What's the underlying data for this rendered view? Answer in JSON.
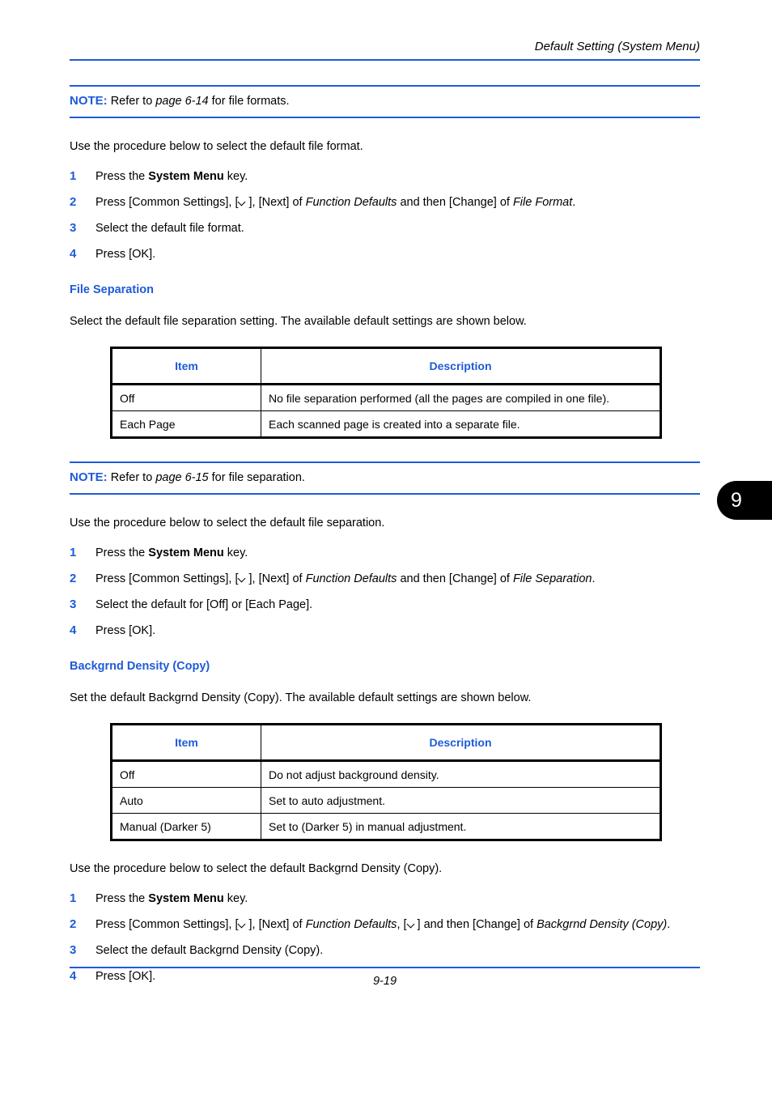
{
  "header": {
    "title": "Default Setting (System Menu)"
  },
  "chapter_tab": {
    "number": "9"
  },
  "notes": {
    "file_format": {
      "label": "NOTE:",
      "prefix": " Refer to ",
      "reference": "page 6-14",
      "suffix": " for file formats."
    },
    "file_separation": {
      "label": "NOTE:",
      "prefix": " Refer to ",
      "reference": "page 6-15",
      "suffix": " for file separation."
    }
  },
  "intro_file_format": "Use the procedure below to select the default file format.",
  "steps_file_format": [
    {
      "num": "1",
      "pre": "Press the ",
      "bold": "System Menu",
      "post": " key."
    },
    {
      "num": "2",
      "p1": "Press [Common Settings], [",
      "p2": "], [Next] of ",
      "i1": "Function Defaults",
      "p3": " and then [Change] of ",
      "i2": "File Format",
      "p4": "."
    },
    {
      "num": "3",
      "text": "Select the default file format."
    },
    {
      "num": "4",
      "text": "Press [OK]."
    }
  ],
  "file_separation_section": {
    "heading": "File Separation",
    "intro": "Select the default file separation setting. The available default settings are shown below.",
    "table": {
      "columns": [
        "Item",
        "Description"
      ],
      "rows": [
        [
          "Off",
          "No file separation performed (all the pages are compiled in one file)."
        ],
        [
          "Each Page",
          "Each scanned page is created into a separate file."
        ]
      ]
    },
    "procedure_intro": "Use the procedure below to select the default file separation.",
    "steps": [
      {
        "num": "1",
        "pre": "Press the ",
        "bold": "System Menu",
        "post": " key."
      },
      {
        "num": "2",
        "p1": "Press [Common Settings], [",
        "p2": "], [Next] of ",
        "i1": "Function Defaults",
        "p3": " and then [Change] of ",
        "i2": "File Separation",
        "p4": "."
      },
      {
        "num": "3",
        "text": "Select the default for [Off] or [Each Page]."
      },
      {
        "num": "4",
        "text": "Press [OK]."
      }
    ]
  },
  "backgrnd_density_section": {
    "heading": "Backgrnd Density (Copy)",
    "intro": "Set the default Backgrnd Density (Copy). The available default settings are shown below.",
    "table": {
      "columns": [
        "Item",
        "Description"
      ],
      "rows": [
        [
          "Off",
          "Do not adjust background density."
        ],
        [
          "Auto",
          "Set to auto adjustment."
        ],
        [
          "Manual (Darker 5)",
          "Set to (Darker 5) in manual adjustment."
        ]
      ]
    },
    "procedure_intro": "Use the procedure below to select the default Backgrnd Density (Copy).",
    "steps": [
      {
        "num": "1",
        "pre": "Press the ",
        "bold": "System Menu",
        "post": " key."
      },
      {
        "num": "2",
        "p1": "Press [Common Settings], [",
        "p2": "], [Next] of ",
        "i1": "Function Defaults",
        "p3": ", [",
        "p4": "] and then [Change] of ",
        "i2": "Backgrnd Density (Copy)",
        "p5": "."
      },
      {
        "num": "3",
        "text": "Select the default Backgrnd Density (Copy)."
      },
      {
        "num": "4",
        "text": "Press [OK]."
      }
    ]
  },
  "footer": {
    "page_number": "9-19"
  },
  "colors": {
    "accent_blue": "#1F5BD8",
    "text_black": "#000000",
    "tab_black": "#000000"
  }
}
